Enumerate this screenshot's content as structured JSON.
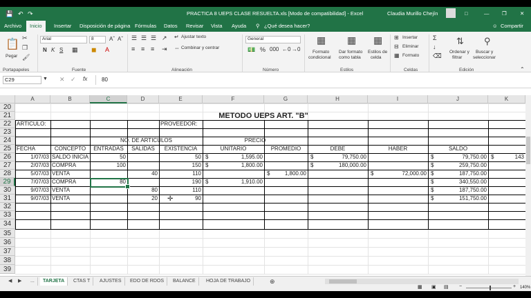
{
  "title_bar": {
    "document_title": "PRACTICA 8 UEPS CLASE RESUELTA.xls  [Modo de compatibilidad]  -  Excel",
    "user_name": "Claudia Murillo Chejín"
  },
  "ribbon_tabs": [
    "Archivo",
    "Inicio",
    "Insertar",
    "Disposición de página",
    "Fórmulas",
    "Datos",
    "Revisar",
    "Vista",
    "Ayuda"
  ],
  "tell_me": "¿Qué desea hacer?",
  "share_label": "Compartir",
  "ribbon": {
    "paste_label": "Pegar",
    "font_name": "Arial",
    "font_size": "8",
    "wrap_text": "Ajustar texto",
    "merge_center": "Combinar y centrar",
    "number_format": "General",
    "conditional_format": [
      "Formato",
      "condicional"
    ],
    "format_table": [
      "Dar formato",
      "como tabla"
    ],
    "cell_styles": [
      "Estilos de",
      "celda"
    ],
    "insert": "Insertar",
    "delete": "Eliminar",
    "format": "Formato",
    "sort_filter": [
      "Ordenar y",
      "filtrar"
    ],
    "find_select": [
      "Buscar y",
      "seleccionar"
    ],
    "groups": [
      "Portapapeles",
      "Fuente",
      "Alineación",
      "Número",
      "Estilos",
      "Celdas",
      "Edición"
    ]
  },
  "formula_bar": {
    "name_box": "C29",
    "fx": "fx",
    "value": "80"
  },
  "columns": [
    "A",
    "B",
    "C",
    "D",
    "E",
    "F",
    "G",
    "H",
    "I",
    "J",
    "K"
  ],
  "selected_column": "C",
  "rows": [
    "20",
    "21",
    "22",
    "23",
    "24",
    "25",
    "26",
    "27",
    "28",
    "29",
    "30",
    "31",
    "32",
    "33",
    "34",
    "35",
    "36",
    "37",
    "38",
    "39"
  ],
  "selected_row": "29",
  "sheet": {
    "title": "METODO UEPS ART. \"B\"",
    "articulo": "ARTICULO:",
    "proveedor": "PROVEEDOR:",
    "no_articulos": "NO. DE ARTICULOS",
    "precio": "PRECIO",
    "headers": [
      "FECHA",
      "CONCEPTO",
      "ENTRADAS",
      "SALIDAS",
      "EXISTENCIA",
      "UNITARIO",
      "PROMEDIO",
      "DEBE",
      "HABER",
      "SALDO"
    ],
    "data_rows": [
      {
        "fecha": "1/07/03",
        "concepto": "SALDO INICIAL",
        "entradas": "50",
        "salidas": "",
        "existencia": "50",
        "unitario": "1,595.00",
        "promedio": "",
        "debe": "79,750.00",
        "haber": "",
        "saldo": "79,750.00",
        "k": "143"
      },
      {
        "fecha": "2/07/03",
        "concepto": "COMPRA",
        "entradas": "100",
        "salidas": "",
        "existencia": "150",
        "unitario": "1,800.00",
        "promedio": "",
        "debe": "180,000.00",
        "haber": "",
        "saldo": "259,750.00",
        "k": ""
      },
      {
        "fecha": "5/07/03",
        "concepto": "VENTA",
        "entradas": "",
        "salidas": "40",
        "existencia": "110",
        "unitario": "",
        "promedio": "1,800.00",
        "debe": "",
        "haber": "72,000.00",
        "saldo": "187,750.00",
        "k": ""
      },
      {
        "fecha": "7/07/03",
        "concepto": "COMPRA",
        "entradas": "80",
        "salidas": "",
        "existencia": "190",
        "unitario": "1,910.00",
        "promedio": "",
        "debe": "",
        "haber": "",
        "saldo": "340,550.00",
        "k": ""
      },
      {
        "fecha": "9/07/03",
        "concepto": "VENTA",
        "entradas": "",
        "salidas": "80",
        "existencia": "110",
        "unitario": "",
        "promedio": "",
        "debe": "",
        "haber": "",
        "saldo": "187,750.00",
        "k": ""
      },
      {
        "fecha": "9/07/03",
        "concepto": "VENTA",
        "entradas": "",
        "salidas": "20",
        "existencia": "90",
        "unitario": "",
        "promedio": "",
        "debe": "",
        "haber": "",
        "saldo": "151,750.00",
        "k": ""
      }
    ],
    "currency": "$"
  },
  "sheet_tabs": [
    "...",
    "TARJETA",
    "CTAS T",
    "AJUSTES",
    "EDO DE RDOS",
    "BALANCE",
    "HOJA DE TRABAJO"
  ],
  "active_sheet": "TARJETA",
  "zoom": "140%",
  "colors": {
    "accent": "#217346"
  }
}
